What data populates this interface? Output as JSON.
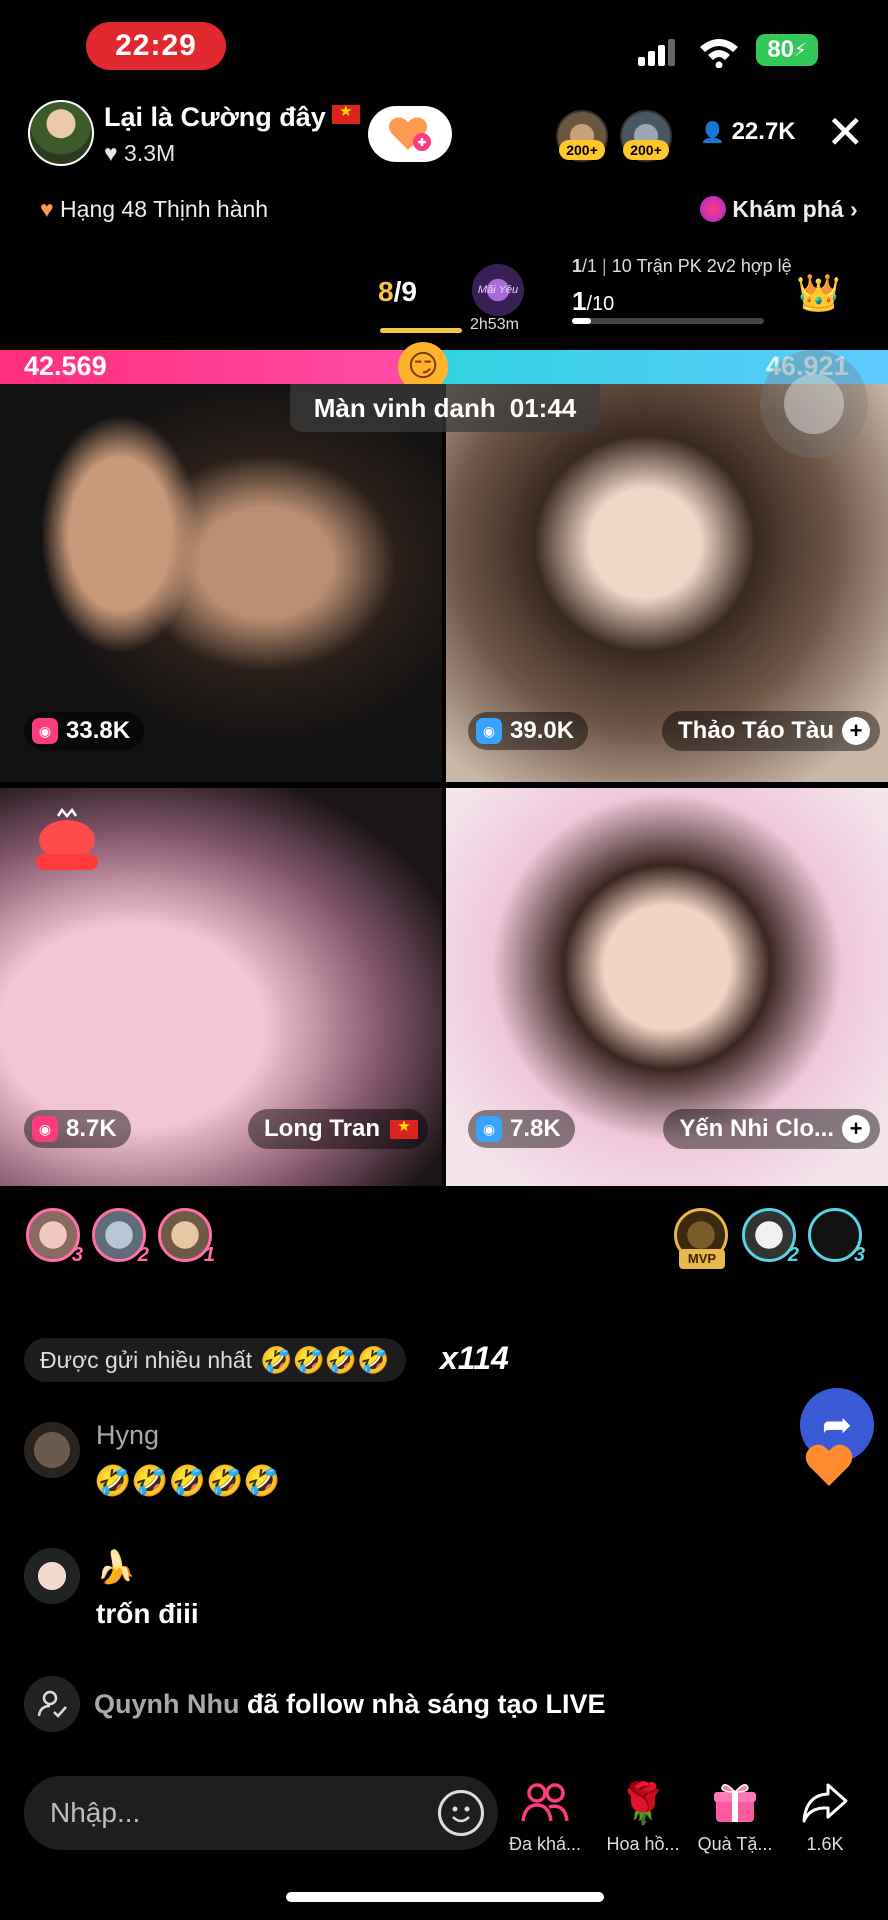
{
  "status_bar": {
    "time": "22:29",
    "battery": "80"
  },
  "header": {
    "host_name": "Lại là Cường đây",
    "host_likes": "3.3M",
    "top_viewers": [
      {
        "tag": "200+"
      },
      {
        "tag": "200+"
      }
    ],
    "viewer_count": "22.7K",
    "rank_label": "Hạng 48 Thịnh hành",
    "explore_label": "Khám phá"
  },
  "pk": {
    "round_current": "8",
    "round_total": "/9",
    "boss_time": "2h53m",
    "boss_label": "Mãi Yêu",
    "line1_count": "1",
    "line1_total": "/1",
    "line1_label": "10 Trận PK 2v2 hợp lệ",
    "progress_current": "1",
    "progress_total": "/10",
    "progress_fraction": 0.1
  },
  "score": {
    "left": "42.569",
    "right": "46.921",
    "left_fraction": 0.476,
    "honor_label": "Màn vinh danh",
    "honor_time": "01:44"
  },
  "tiles": [
    {
      "points": "33.8K",
      "name": ""
    },
    {
      "points": "39.0K",
      "name": "Thảo Táo Tàu"
    },
    {
      "points": "8.7K",
      "name": "Long Tran"
    },
    {
      "points": "7.8K",
      "name": "Yến Nhi Clo..."
    }
  ],
  "contributors": {
    "left": [
      {
        "num": "3"
      },
      {
        "num": "2"
      },
      {
        "num": "1"
      }
    ],
    "right": [
      {
        "tag": "MVP"
      },
      {
        "num": "2"
      },
      {
        "num": "3"
      }
    ]
  },
  "chat": {
    "most_sent_label": "Được gửi nhiều nhất",
    "most_sent_emojis": "🤣🤣🤣🤣",
    "most_sent_count": "x114",
    "messages": [
      {
        "name": "Hyng",
        "text": "🤣🤣🤣🤣🤣"
      },
      {
        "name": "",
        "emoji": "🍌",
        "text": "trốn điii"
      }
    ],
    "follow_user": "Quynh Nhu",
    "follow_text": "đã follow nhà sáng tạo LIVE"
  },
  "bottom_bar": {
    "input_placeholder": "Nhập...",
    "actions": [
      {
        "icon": "people-icon",
        "label": "Đa khá..."
      },
      {
        "icon": "rose-icon",
        "label": "Hoa hồ..."
      },
      {
        "icon": "gift-icon",
        "label": "Quà Tặ..."
      },
      {
        "icon": "share-icon",
        "label": "1.6K"
      }
    ]
  },
  "colors": {
    "accent_pink": "#ff2e7e",
    "accent_cyan": "#30d3e0",
    "gold": "#f5c542",
    "status_red": "#e0282e"
  }
}
